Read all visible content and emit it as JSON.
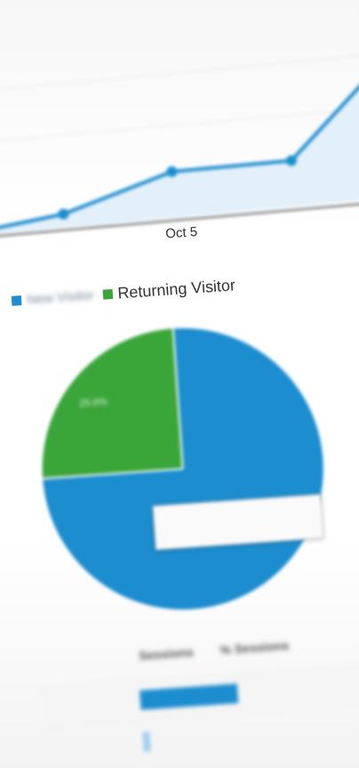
{
  "line_chart": {
    "x_tick_label": "Oct 5",
    "series_color": "#1c8dcf"
  },
  "pie": {
    "legend": [
      {
        "label": "New Visitor",
        "color": "#1c8dcf"
      },
      {
        "label": "Returning Visitor",
        "color": "#3aa639"
      }
    ],
    "returning_share": 0.25,
    "slice_label": "25.6%",
    "tooltip_line1": "",
    "tooltip_line2": ""
  },
  "table": {
    "headers": [
      "Sessions",
      "% Sessions"
    ],
    "rows": [
      {
        "value": "",
        "fill": 0.9,
        "pct": ""
      },
      {
        "value": "",
        "fill": 0.04,
        "pct": ""
      }
    ]
  }
}
